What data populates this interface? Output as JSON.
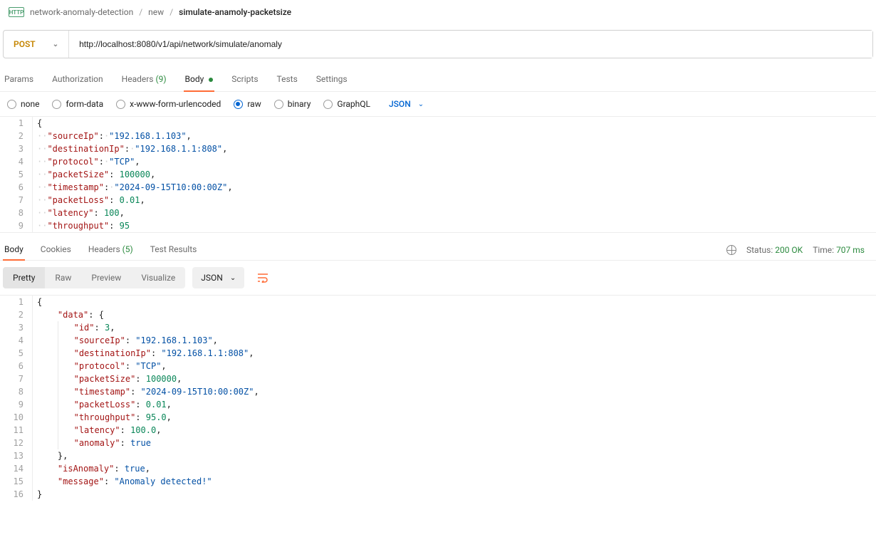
{
  "breadcrumb": {
    "badge": "HTTP",
    "items": [
      "network-anomaly-detection",
      "new",
      "simulate-anamoly-packetsize"
    ]
  },
  "request": {
    "method": "POST",
    "url": "http://localhost:8080/v1/api/network/simulate/anomaly"
  },
  "tabs": {
    "params": "Params",
    "auth": "Authorization",
    "headers": "Headers",
    "headers_count": "(9)",
    "body": "Body",
    "scripts": "Scripts",
    "tests": "Tests",
    "settings": "Settings"
  },
  "body_types": {
    "none": "none",
    "form_data": "form-data",
    "urlencoded": "x-www-form-urlencoded",
    "raw": "raw",
    "binary": "binary",
    "graphql": "GraphQL",
    "json_label": "JSON"
  },
  "request_body": {
    "l1": "{",
    "l2_k": "\"sourceIp\"",
    "l2_v": "\"192.168.1.103\"",
    "l3_k": "\"destinationIp\"",
    "l3_v": "\"192.168.1.1:808\"",
    "l4_k": "\"protocol\"",
    "l4_v": "\"TCP\"",
    "l5_k": "\"packetSize\"",
    "l5_v": "100000",
    "l6_k": "\"timestamp\"",
    "l6_v": "\"2024-09-15T10:00:00Z\"",
    "l7_k": "\"packetLoss\"",
    "l7_v": "0.01",
    "l8_k": "\"latency\"",
    "l8_v": "100",
    "l9_k": "\"throughput\"",
    "l9_v": "95"
  },
  "response_tabs": {
    "body": "Body",
    "cookies": "Cookies",
    "headers": "Headers",
    "headers_count": "(5)",
    "test_results": "Test Results"
  },
  "response_status": {
    "status_label": "Status:",
    "status_value": "200 OK",
    "time_label": "Time:",
    "time_value": "707 ms"
  },
  "response_modes": {
    "pretty": "Pretty",
    "raw": "Raw",
    "preview": "Preview",
    "visualize": "Visualize",
    "json": "JSON"
  },
  "response_body": {
    "l1": "{",
    "l2_k": "\"data\"",
    "l2_v": "{",
    "l3_k": "\"id\"",
    "l3_v": "3",
    "l4_k": "\"sourceIp\"",
    "l4_v": "\"192.168.1.103\"",
    "l5_k": "\"destinationIp\"",
    "l5_v": "\"192.168.1.1:808\"",
    "l6_k": "\"protocol\"",
    "l6_v": "\"TCP\"",
    "l7_k": "\"packetSize\"",
    "l7_v": "100000",
    "l8_k": "\"timestamp\"",
    "l8_v": "\"2024-09-15T10:00:00Z\"",
    "l9_k": "\"packetLoss\"",
    "l9_v": "0.01",
    "l10_k": "\"throughput\"",
    "l10_v": "95.0",
    "l11_k": "\"latency\"",
    "l11_v": "100.0",
    "l12_k": "\"anomaly\"",
    "l12_v": "true",
    "l13": "},",
    "l14_k": "\"isAnomaly\"",
    "l14_v": "true",
    "l15_k": "\"message\"",
    "l15_v": "\"Anomaly detected!\"",
    "l16": "}"
  },
  "line_numbers": {
    "n1": "1",
    "n2": "2",
    "n3": "3",
    "n4": "4",
    "n5": "5",
    "n6": "6",
    "n7": "7",
    "n8": "8",
    "n9": "9",
    "n10": "10",
    "n11": "11",
    "n12": "12",
    "n13": "13",
    "n14": "14",
    "n15": "15",
    "n16": "16"
  }
}
